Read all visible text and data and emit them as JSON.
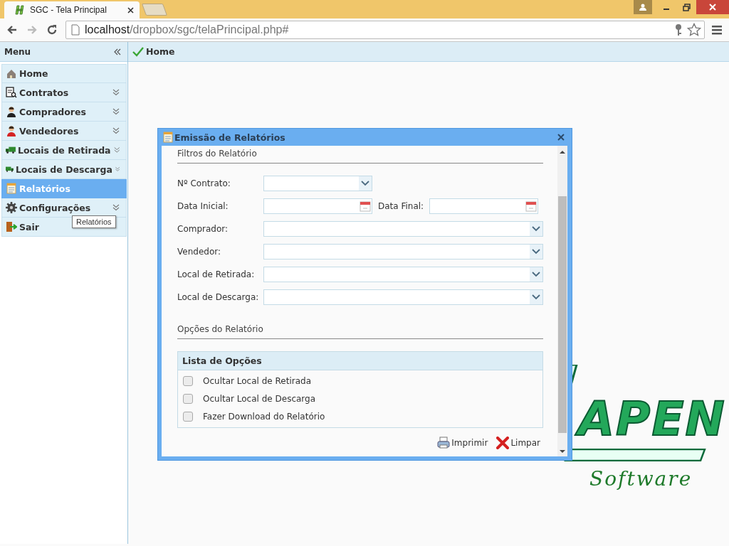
{
  "browser": {
    "tab_title": "SGC - Tela Principal",
    "url_host": "localhost",
    "url_path": "/dropbox/sgc/telaPrincipal.php#"
  },
  "sidebar": {
    "title": "Menu",
    "items": [
      {
        "label": "Home",
        "expandable": false,
        "selected": false
      },
      {
        "label": "Contratos",
        "expandable": true,
        "selected": false
      },
      {
        "label": "Compradores",
        "expandable": true,
        "selected": false
      },
      {
        "label": "Vendedores",
        "expandable": true,
        "selected": false
      },
      {
        "label": "Locais de Retirada",
        "expandable": true,
        "selected": false
      },
      {
        "label": "Locais de Descarga",
        "expandable": true,
        "selected": false
      },
      {
        "label": "Relatórios",
        "expandable": false,
        "selected": true
      },
      {
        "label": "Configurações",
        "expandable": true,
        "selected": false
      },
      {
        "label": "Sair",
        "expandable": false,
        "selected": false
      }
    ]
  },
  "tooltip": "Relatórios",
  "main": {
    "tab": "Home"
  },
  "logo": {
    "wordmark": "APEN",
    "tagline": "Software"
  },
  "dialog": {
    "title": "Emissão de Relatórios",
    "filters_heading": "Filtros do Relatório",
    "rows": [
      {
        "fields": [
          {
            "label": "Nº Contrato:",
            "kind": "short-combo"
          }
        ]
      },
      {
        "fields": [
          {
            "label": "Data Inicial:",
            "kind": "date"
          },
          {
            "label": "Data Final:",
            "kind": "date"
          }
        ]
      },
      {
        "fields": [
          {
            "label": "Comprador:",
            "kind": "combo"
          }
        ]
      },
      {
        "fields": [
          {
            "label": "Vendedor:",
            "kind": "combo"
          }
        ]
      },
      {
        "fields": [
          {
            "label": "Local de Retirada:",
            "kind": "combo"
          }
        ]
      },
      {
        "fields": [
          {
            "label": "Local de Descarga:",
            "kind": "combo"
          }
        ]
      }
    ],
    "options_heading": "Opções do Relatório",
    "options_list": {
      "title": "Lista de Opções",
      "items": [
        {
          "label": "Ocultar Local de Retirada",
          "checked": false
        },
        {
          "label": "Ocultar Local de Descarga",
          "checked": false
        },
        {
          "label": "Fazer Download do Relatório",
          "checked": false
        }
      ]
    },
    "buttons": [
      {
        "label": "Imprimir",
        "kind": "print"
      },
      {
        "label": "Limpar",
        "kind": "clear"
      }
    ]
  }
}
